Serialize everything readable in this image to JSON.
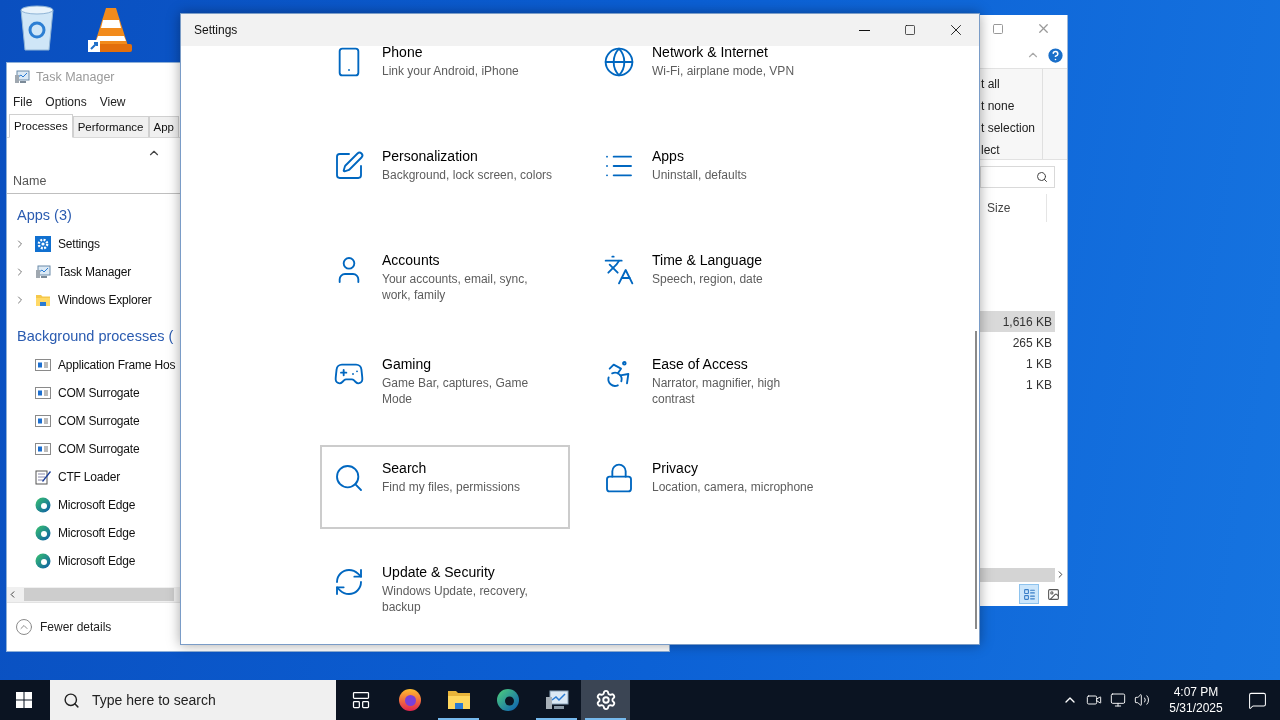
{
  "desktop_icons": [
    {
      "kind": "recycle-bin"
    },
    {
      "kind": "cone"
    }
  ],
  "task_manager": {
    "title": "Task Manager",
    "menu": [
      "File",
      "Options",
      "View"
    ],
    "tabs": [
      {
        "label": "Processes",
        "selected": true
      },
      {
        "label": "Performance",
        "selected": false
      },
      {
        "label": "App",
        "selected": false
      }
    ],
    "name_column": "Name",
    "groups": [
      {
        "title": "Apps (3)",
        "rows": [
          {
            "name": "Settings",
            "kind": "gear",
            "expandable": true
          },
          {
            "name": "Task Manager",
            "kind": "monitor",
            "expandable": true
          },
          {
            "name": "Windows Explorer",
            "kind": "folder",
            "expandable": true
          }
        ]
      },
      {
        "title": "Background processes (",
        "rows": [
          {
            "name": "Application Frame Hos",
            "kind": "window",
            "expandable": false
          },
          {
            "name": "COM Surrogate",
            "kind": "window",
            "expandable": false
          },
          {
            "name": "COM Surrogate",
            "kind": "window",
            "expandable": false
          },
          {
            "name": "COM Surrogate",
            "kind": "window",
            "expandable": false
          },
          {
            "name": "CTF Loader",
            "kind": "notepad",
            "expandable": false
          },
          {
            "name": "Microsoft Edge",
            "kind": "edge",
            "expandable": false
          },
          {
            "name": "Microsoft Edge",
            "kind": "edge",
            "expandable": false
          },
          {
            "name": "Microsoft Edge",
            "kind": "edge",
            "expandable": false
          }
        ]
      }
    ],
    "footer": "Fewer details"
  },
  "explorer": {
    "ribbon_items": [
      "t all",
      "t none",
      "t selection",
      "lect"
    ],
    "size_column": "Size",
    "rows": [
      {
        "size": "1,616 KB",
        "selected": true
      },
      {
        "size": "265 KB",
        "selected": false
      },
      {
        "size": "1 KB",
        "selected": false
      },
      {
        "size": "1 KB",
        "selected": false
      }
    ]
  },
  "settings": {
    "title": "Settings",
    "items": [
      {
        "kind": "phone",
        "title": "Phone",
        "subtitle": [
          "Link your Android, iPhone"
        ],
        "selected": false
      },
      {
        "kind": "globe",
        "title": "Network & Internet",
        "subtitle": [
          "Wi-Fi, airplane mode, VPN"
        ],
        "selected": false
      },
      {
        "kind": "pen",
        "title": "Personalization",
        "subtitle": [
          "Background, lock screen, colors"
        ],
        "selected": false
      },
      {
        "kind": "list",
        "title": "Apps",
        "subtitle": [
          "Uninstall, defaults"
        ],
        "selected": false
      },
      {
        "kind": "person",
        "title": "Accounts",
        "subtitle": [
          "Your accounts, email, sync,",
          "work, family"
        ],
        "selected": false
      },
      {
        "kind": "language",
        "title": "Time & Language",
        "subtitle": [
          "Speech, region, date"
        ],
        "selected": false
      },
      {
        "kind": "gamepad",
        "title": "Gaming",
        "subtitle": [
          "Game Bar, captures, Game",
          "Mode"
        ],
        "selected": false
      },
      {
        "kind": "access",
        "title": "Ease of Access",
        "subtitle": [
          "Narrator, magnifier, high",
          "contrast"
        ],
        "selected": false
      },
      {
        "kind": "search",
        "title": "Search",
        "subtitle": [
          "Find my files, permissions"
        ],
        "selected": true
      },
      {
        "kind": "lock",
        "title": "Privacy",
        "subtitle": [
          "Location, camera, microphone"
        ],
        "selected": false
      },
      {
        "kind": "refresh",
        "title": "Update & Security",
        "subtitle": [
          "Windows Update, recovery,",
          "backup"
        ],
        "selected": false
      }
    ]
  },
  "taskbar": {
    "search_placeholder": "Type here to search",
    "apps": [
      {
        "kind": "task-view",
        "open": false,
        "active": false
      },
      {
        "kind": "firefox",
        "open": false,
        "active": false
      },
      {
        "kind": "folder",
        "open": true,
        "active": false
      },
      {
        "kind": "edge",
        "open": false,
        "active": false
      },
      {
        "kind": "monitor",
        "open": true,
        "active": false
      },
      {
        "kind": "gear",
        "open": true,
        "active": true
      }
    ],
    "clock": {
      "time": "4:07 PM",
      "date": "5/31/2025"
    }
  }
}
